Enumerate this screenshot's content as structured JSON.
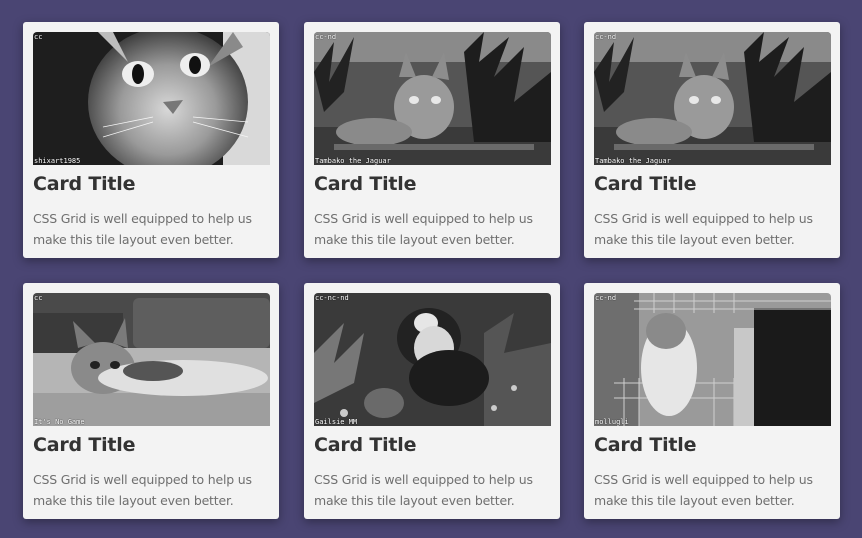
{
  "cards": [
    {
      "license": "cc",
      "credit": "shixart1985",
      "title": "Card Title",
      "description": "CSS Grid is well equipped to help us make this tile layout even better."
    },
    {
      "license": "cc-nd",
      "credit": "Tambako the Jaguar",
      "title": "Card Title",
      "description": "CSS Grid is well equipped to help us make this tile layout even better."
    },
    {
      "license": "cc-nd",
      "credit": "Tambako the Jaguar",
      "title": "Card Title",
      "description": "CSS Grid is well equipped to help us make this tile layout even better."
    },
    {
      "license": "cc",
      "credit": "It's No Game",
      "title": "Card Title",
      "description": "CSS Grid is well equipped to help us make this tile layout even better."
    },
    {
      "license": "cc-nc-nd",
      "credit": "Gailsie MM",
      "title": "Card Title",
      "description": "CSS Grid is well equipped to help us make this tile layout even better."
    },
    {
      "license": "cc-nd",
      "credit": "mollugli",
      "title": "Card Title",
      "description": "CSS Grid is well equipped to help us make this tile layout even better."
    }
  ]
}
